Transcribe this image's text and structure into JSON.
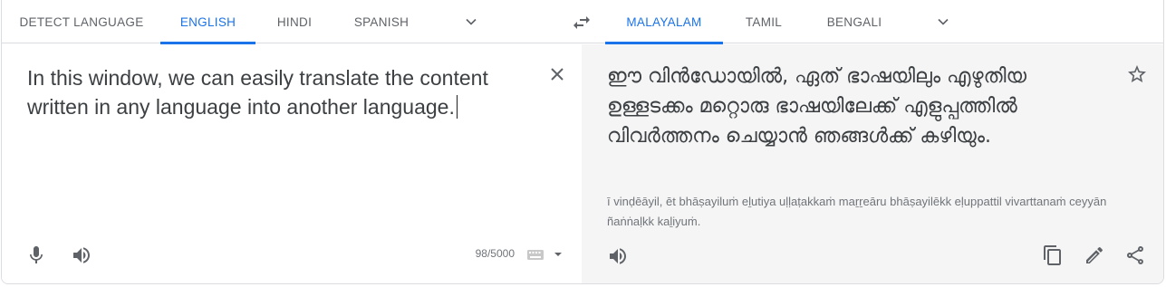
{
  "source_tabs": [
    {
      "label": "DETECT LANGUAGE"
    },
    {
      "label": "ENGLISH"
    },
    {
      "label": "HINDI"
    },
    {
      "label": "SPANISH"
    }
  ],
  "source_active": "ENGLISH",
  "target_tabs": [
    {
      "label": "MALAYALAM"
    },
    {
      "label": "TAMIL"
    },
    {
      "label": "BENGALI"
    }
  ],
  "target_active": "MALAYALAM",
  "source": {
    "text": "In this window, we can easily translate the content written in any language into another language.",
    "char_count": "98/5000"
  },
  "target": {
    "text": "ഈ വിൻഡോയിൽ, ഏത് ഭാഷയിലും എഴുതിയ ഉള്ളടക്കം മറ്റൊരു ഭാഷയിലേക്ക് എളുപ്പത്തിൽ വിവർത്തനം ചെയ്യാൻ ഞങ്ങൾക്ക് കഴിയും.",
    "romanization": "ī vinḍēāyil, ēt bhāṣayiluṁ eḻutiya uḷḷaṭakkaṁ maṟṟeāru bhāṣayilēkk eḷuppattil vivarttanaṁ ceyyān ñaṅṅaḷkk kaḻiyuṁ."
  },
  "icons": {
    "swap": "swap-languages-icon",
    "clear": "close-icon",
    "mic": "microphone-icon",
    "speaker": "speaker-icon",
    "keyboard": "keyboard-icon",
    "star": "star-icon",
    "copy": "copy-icon",
    "edit": "pencil-icon",
    "share": "share-icon"
  },
  "colors": {
    "accent": "#1a73e8",
    "tab_text": "#5f6368",
    "target_bg": "#f5f5f5"
  }
}
